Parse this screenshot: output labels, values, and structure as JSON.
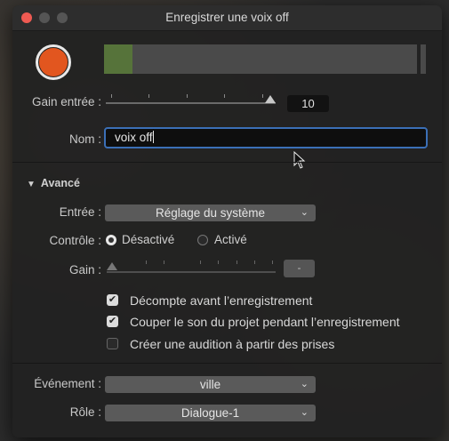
{
  "window": {
    "title": "Enregistrer une voix off"
  },
  "meter": {
    "level": 0.09
  },
  "gain_input": {
    "label": "Gain entrée :",
    "value": "10",
    "slider_fraction": 0.97
  },
  "name": {
    "label": "Nom :",
    "value": "voix off"
  },
  "advanced": {
    "label": "Avancé",
    "input": {
      "label": "Entrée :",
      "value": "Réglage du système"
    },
    "monitor": {
      "label": "Contrôle :",
      "options": [
        "Désactivé",
        "Activé"
      ],
      "selected": "Désactivé"
    },
    "gain": {
      "label": "Gain :",
      "value": "-",
      "slider_fraction": 0.0
    },
    "checkboxes": [
      {
        "label": "Décompte avant l’enregistrement",
        "checked": true
      },
      {
        "label": "Couper le son du projet pendant l’enregistrement",
        "checked": true
      },
      {
        "label": "Créer une audition à partir des prises",
        "checked": false
      }
    ]
  },
  "event": {
    "label": "Événement :",
    "value": "ville"
  },
  "role": {
    "label": "Rôle :",
    "value": "Dialogue-1"
  },
  "colors": {
    "record": "#e2561f",
    "accent_focus": "#3b6fb6",
    "meter_fill": "#56733a"
  },
  "icons": [
    "record-icon",
    "disclosure-triangle-icon",
    "chevron-down-icon",
    "mouse-pointer-icon"
  ]
}
